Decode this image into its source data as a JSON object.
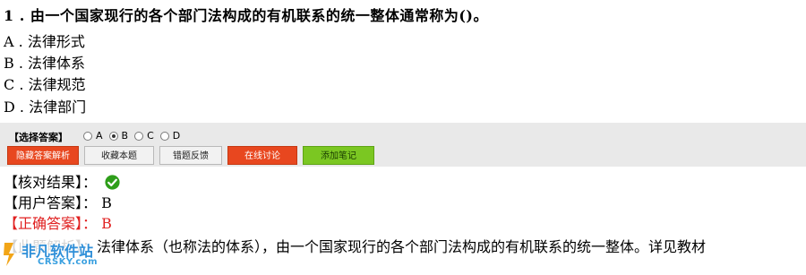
{
  "question": {
    "number": "1 .",
    "text": "由一个国家现行的各个部门法构成的有机联系的统一整体通常称为()。"
  },
  "options": [
    {
      "letter": "A .",
      "text": "法律形式"
    },
    {
      "letter": "B .",
      "text": "法律体系"
    },
    {
      "letter": "C .",
      "text": "法律规范"
    },
    {
      "letter": "D .",
      "text": "法律部门"
    }
  ],
  "answer_panel": {
    "label": "【选择答案】",
    "radios": [
      {
        "label": "A",
        "checked": false
      },
      {
        "label": "B",
        "checked": true
      },
      {
        "label": "C",
        "checked": false
      },
      {
        "label": "D",
        "checked": false
      }
    ]
  },
  "buttons": {
    "hide_analysis": "隐藏答案解析",
    "favorite": "收藏本题",
    "feedback": "错题反馈",
    "discuss": "在线讨论",
    "add_note": "添加笔记"
  },
  "result": {
    "check_label": "【核对结果】：",
    "check_status": "correct",
    "user_label": "【用户答案】：",
    "user_value": "B",
    "correct_label": "【正确答案】：",
    "correct_value": "B"
  },
  "analysis": {
    "label": "【此题解析】：",
    "text": "法律体系（也称法的体系），由一个国家现行的各个部门法构成的有机联系的统一整体。详见教材"
  },
  "watermark": {
    "main": "非凡软件站",
    "sub": "CRSKY.com"
  },
  "colors": {
    "red_button": "#e8471f",
    "green_button": "#7bc722",
    "correct_answer_text": "#e02020",
    "check_icon": "#2e9e1a",
    "panel_bg": "#e9e9e9"
  }
}
